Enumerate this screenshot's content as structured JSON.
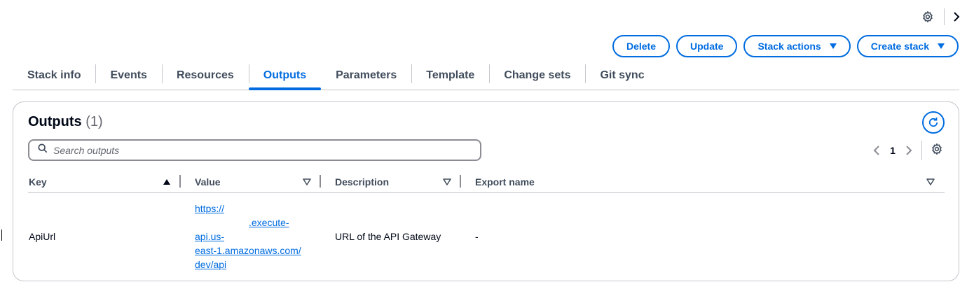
{
  "actions": {
    "delete": "Delete",
    "update": "Update",
    "stack_actions": "Stack actions",
    "create_stack": "Create stack"
  },
  "tabs": [
    {
      "label": "Stack info"
    },
    {
      "label": "Events"
    },
    {
      "label": "Resources"
    },
    {
      "label": "Outputs",
      "active": true
    },
    {
      "label": "Parameters"
    },
    {
      "label": "Template"
    },
    {
      "label": "Change sets"
    },
    {
      "label": "Git sync"
    }
  ],
  "panel": {
    "title": "Outputs",
    "count": "(1)",
    "search_placeholder": "Search outputs",
    "page": "1"
  },
  "table": {
    "columns": [
      "Key",
      "Value",
      "Description",
      "Export name"
    ],
    "rows": [
      {
        "key": "ApiUrl",
        "value_lines": [
          "https://",
          ".execute-",
          "api.us-",
          "east-1.amazonaws.com/",
          "dev/api"
        ],
        "description": "URL of the API Gateway",
        "export_name": "-"
      }
    ]
  },
  "colors": {
    "accent": "#006ce0",
    "border": "#c6c6cd",
    "tab_text": "#414d5c"
  },
  "icons": [
    "settings-gear-icon",
    "chevron-right-icon",
    "caret-down-icon",
    "refresh-icon",
    "search-icon",
    "chevron-left-icon",
    "sort-ascending-icon",
    "sort-descending-icon"
  ]
}
